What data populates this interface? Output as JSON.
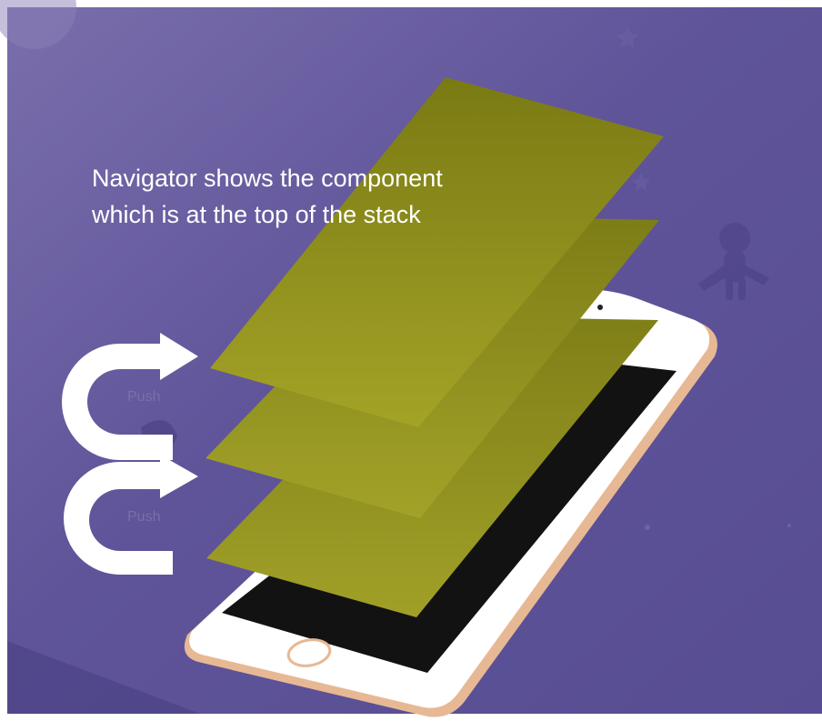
{
  "diagram": {
    "caption_line1": "Navigator shows the component",
    "caption_line2": "which is at the top of the stack",
    "push_labels": [
      "Push",
      "Push"
    ],
    "colors": {
      "background": "#5b5096",
      "layer": "#9c9c26",
      "phone_body": "#ffffff",
      "phone_rim": "#e7b894",
      "screen": "#121212",
      "arrow": "#ffffff"
    }
  }
}
